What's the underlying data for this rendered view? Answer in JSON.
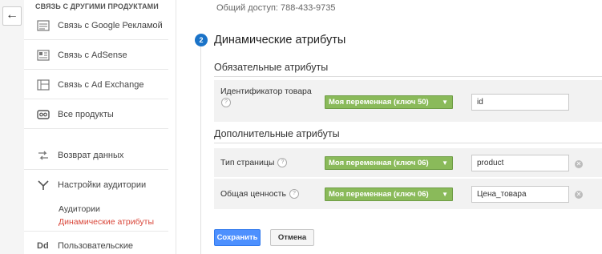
{
  "sidebar": {
    "heading": "СВЯЗЬ С ДРУГИМИ ПРОДУКТАМИ",
    "items": [
      {
        "label": "Связь с Google Рекламой",
        "icon": "google-ads-icon"
      },
      {
        "label": "Связь с AdSense",
        "icon": "adsense-icon"
      },
      {
        "label": "Связь с Ad Exchange",
        "icon": "ad-exchange-icon"
      },
      {
        "label": "Все продукты",
        "icon": "all-products-icon"
      },
      {
        "label": "Возврат данных",
        "icon": "data-import-icon"
      },
      {
        "label": "Настройки аудитории",
        "icon": "audience-icon"
      },
      {
        "label": "Пользовательские",
        "icon": "custom-definitions-icon",
        "icon_text": "Dd"
      }
    ],
    "sub_items": [
      {
        "label": "Аудитории"
      },
      {
        "label": "Динамические атрибуты",
        "active": true
      }
    ]
  },
  "main": {
    "share_text": "Общий доступ: 788-433-9735",
    "step_number": "2",
    "section_title": "Динамические атрибуты",
    "required_title": "Обязательные атрибуты",
    "optional_title": "Дополнительные атрибуты",
    "help_glyph": "?",
    "remove_glyph": "✕",
    "attributes": [
      {
        "label": "Идентификатор товара",
        "variable": "Моя переменная (ключ 50)",
        "value": "id"
      },
      {
        "label": "Тип страницы",
        "variable": "Моя переменная (ключ 06)",
        "value": "product"
      },
      {
        "label": "Общая ценность",
        "variable": "Моя переменная (ключ 06)",
        "value": "Цена_товара"
      }
    ],
    "save_label": "Сохранить",
    "cancel_label": "Отмена"
  },
  "colors": {
    "accent": "#1a73c8",
    "variable_green": "#8aba5a",
    "active_link": "#d9473a",
    "primary_button": "#4d90fe"
  }
}
